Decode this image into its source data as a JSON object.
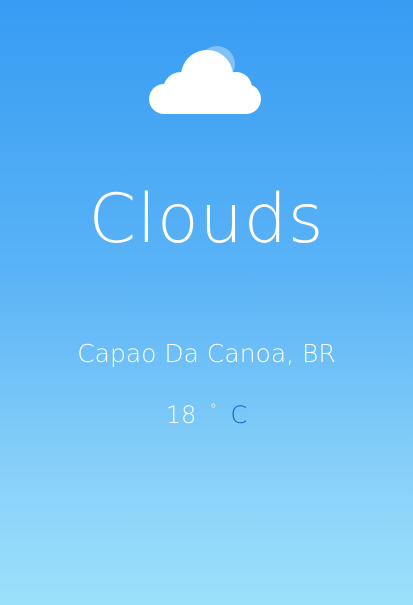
{
  "weather": {
    "condition": "Clouds",
    "icon": "cloud-icon",
    "location": "Capao Da Canoa, BR",
    "temperature": "18",
    "degree_symbol": "°",
    "unit": "C"
  },
  "colors": {
    "background_top": "#379cf3",
    "background_bottom": "#9ce1fb",
    "text": "#ffffff",
    "unit_link": "#1565c0"
  }
}
